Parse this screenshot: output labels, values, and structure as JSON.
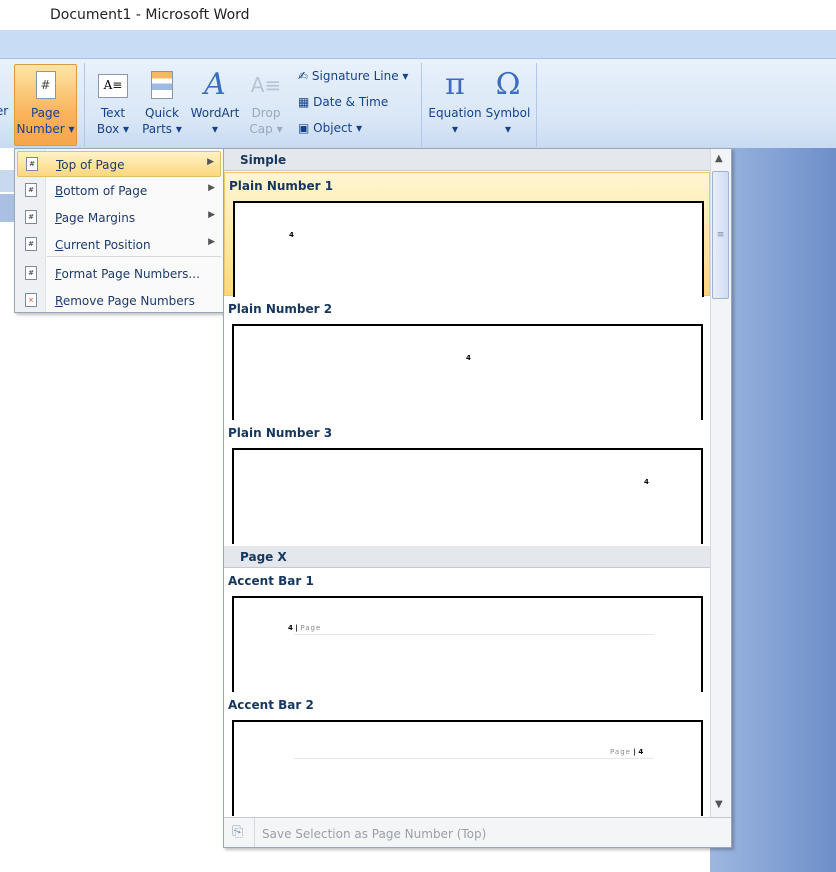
{
  "window": {
    "title": "Document1 - Microsoft Word"
  },
  "ribbon": {
    "partial_left": "er",
    "page_number": {
      "line1": "Page",
      "line2": "Number"
    },
    "text_box": {
      "line1": "Text",
      "line2": "Box"
    },
    "quick_parts": {
      "line1": "Quick",
      "line2": "Parts"
    },
    "wordart": {
      "line1": "WordArt"
    },
    "drop_cap": {
      "line1": "Drop",
      "line2": "Cap"
    },
    "signature_line": "Signature Line",
    "date_time": "Date & Time",
    "object": "Object",
    "equation": {
      "line1": "Equation",
      "glyph": "π"
    },
    "symbol": {
      "line1": "Symbol",
      "glyph": "Ω"
    }
  },
  "menu": {
    "items": [
      {
        "label": "Top of Page",
        "accel": "T",
        "rest": "op of Page",
        "submenu": true,
        "icon": "page-top-icon"
      },
      {
        "label": "Bottom of Page",
        "accel": "B",
        "rest": "ottom of Page",
        "submenu": true,
        "icon": "page-bottom-icon"
      },
      {
        "label": "Page Margins",
        "accel": "P",
        "rest": "age Margins",
        "submenu": true,
        "icon": "page-margins-icon"
      },
      {
        "label": "Current Position",
        "accel": "C",
        "rest": "urrent Position",
        "submenu": true,
        "icon": "current-position-icon"
      },
      {
        "label": "Format Page Numbers...",
        "accel": "F",
        "rest": "ormat Page Numbers...",
        "icon": "format-icon"
      },
      {
        "label": "Remove Page Numbers",
        "accel": "R",
        "rest": "emove Page Numbers",
        "icon": "remove-icon"
      }
    ]
  },
  "gallery": {
    "sections": [
      "Simple",
      "Page X"
    ],
    "items": [
      {
        "label": "Plain Number 1",
        "preview": "4"
      },
      {
        "label": "Plain Number 2",
        "preview": "4"
      },
      {
        "label": "Plain Number 3",
        "preview": "4"
      },
      {
        "label": "Accent Bar 1",
        "preview_num": "4",
        "preview_text": "Page"
      },
      {
        "label": "Accent Bar 2",
        "preview_num": "4",
        "preview_text": "Page"
      }
    ],
    "footer": "Save Selection as Page Number (Top)"
  },
  "colors": {
    "highlight": "#fcd77e",
    "ribbon": "#d8e6f6",
    "text": "#15428b"
  }
}
